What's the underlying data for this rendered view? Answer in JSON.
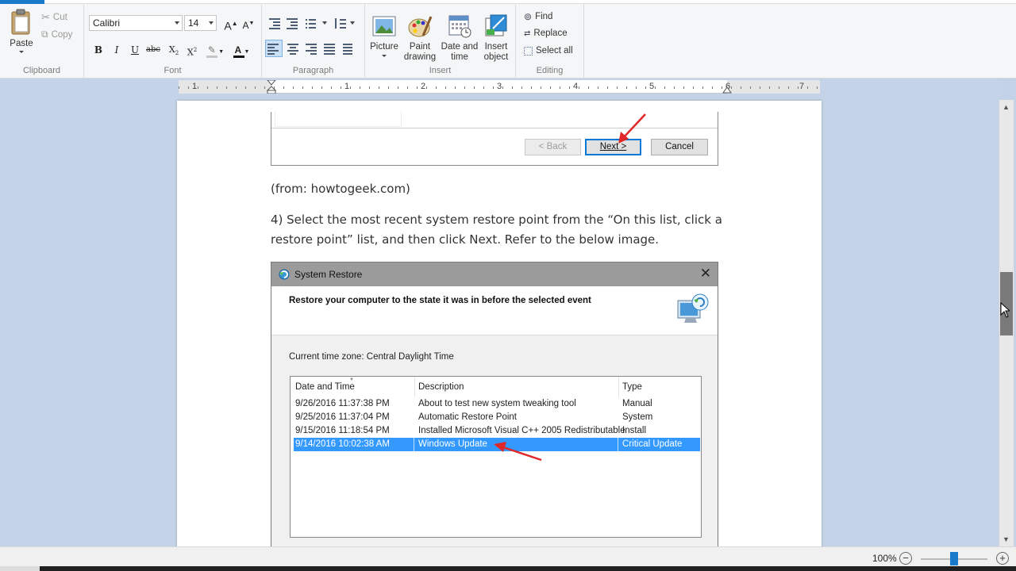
{
  "ribbon": {
    "clipboard": {
      "paste": "Paste",
      "cut": "Cut",
      "copy": "Copy",
      "label": "Clipboard"
    },
    "font": {
      "family": "Calibri",
      "size": "14",
      "label": "Font"
    },
    "paragraph": {
      "label": "Paragraph"
    },
    "insert": {
      "picture": "Picture",
      "paint_1": "Paint",
      "paint_2": "drawing",
      "datetime_1": "Date and",
      "datetime_2": "time",
      "object_1": "Insert",
      "object_2": "object",
      "label": "Insert"
    },
    "editing": {
      "find": "Find",
      "replace": "Replace",
      "select_all": "Select all",
      "label": "Editing"
    }
  },
  "ruler": {
    "numbers": [
      "1",
      "1",
      "2",
      "3",
      "4",
      "5",
      "6",
      "7"
    ]
  },
  "document": {
    "top_dialog": {
      "back": "< Back",
      "next": "Next >",
      "cancel": "Cancel"
    },
    "source_line": "(from: howtogeek.com)",
    "step_line_1": "4) Select the most recent system restore point from the “On this list, click a",
    "step_line_2": "restore point” list, and then click Next. Refer to the below image.",
    "restore_dialog": {
      "title": "System Restore",
      "heading": "Restore your computer to the state it was in before the selected event",
      "timezone": "Current time zone: Central Daylight Time",
      "columns": [
        "Date and Time",
        "Description",
        "Type"
      ],
      "rows": [
        {
          "date": "9/26/2016 11:37:38 PM",
          "desc": "About to test new system tweaking tool",
          "type": "Manual"
        },
        {
          "date": "9/25/2016 11:37:04 PM",
          "desc": "Automatic Restore Point",
          "type": "System"
        },
        {
          "date": "9/15/2016 11:18:54 PM",
          "desc": "Installed Microsoft Visual C++ 2005 Redistributable",
          "type": "Install"
        },
        {
          "date": "9/14/2016 10:02:38 AM",
          "desc": "Windows Update",
          "type": "Critical Update"
        }
      ]
    }
  },
  "statusbar": {
    "zoom": "100%",
    "minus": "−",
    "plus": "+"
  },
  "colors": {
    "accent": "#1979ca",
    "selection": "#3399ff",
    "arrow": "#e02828"
  }
}
